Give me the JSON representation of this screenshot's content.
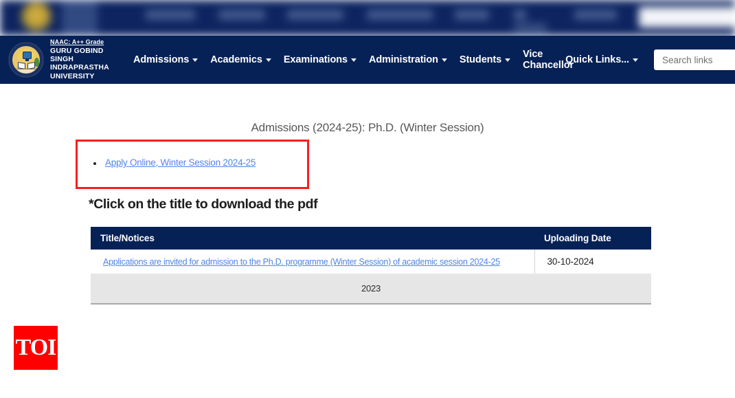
{
  "colors": {
    "navy": "#062156",
    "link_blue": "#4f86e8",
    "annotation_red": "#f81f1f",
    "year_row_grey": "#e6e6e6",
    "toi_red": "#fe0000"
  },
  "header": {
    "naac_text": "NAAC: A++ Grade",
    "university_name": "GURU GOBIND SINGH INDRAPRASTHA UNIVERSITY",
    "crest_alt": "university-crest",
    "nav_items": [
      {
        "label": "Admissions",
        "has_caret": true
      },
      {
        "label": "Academics",
        "has_caret": true
      },
      {
        "label": "Examinations",
        "has_caret": true
      },
      {
        "label": "Administration",
        "has_caret": true
      },
      {
        "label": "Students",
        "has_caret": true
      },
      {
        "label": "Vice Chancellor",
        "has_caret": false
      },
      {
        "label": "Quick Links...",
        "has_caret": true
      }
    ],
    "search": {
      "placeholder": "Search links",
      "value": ""
    }
  },
  "main": {
    "page_title": "Admissions (2024-25): Ph.D. (Winter Session)",
    "apply_link": "Apply Online, Winter Session 2024-25",
    "note": "*Click on the title to download the pdf",
    "table": {
      "headers": [
        "Title/Notices",
        "Uploading Date"
      ],
      "rows": [
        {
          "title": "Applications are invited for admission to the Ph.D. programme (Winter Session) of academic session 2024-25",
          "date": "30-10-2024"
        }
      ],
      "year_divider": "2023"
    }
  },
  "watermark": {
    "label": "TOI"
  }
}
